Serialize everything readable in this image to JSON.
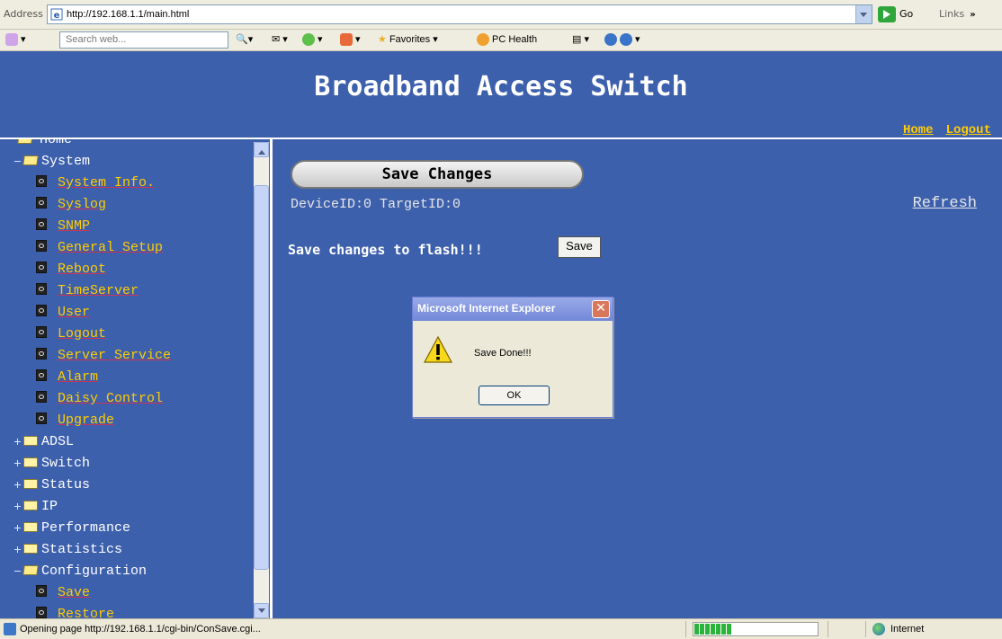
{
  "address_bar": {
    "label": "Address",
    "url": "http://192.168.1.1/main.html",
    "go_label": "Go",
    "links_label": "Links"
  },
  "toolbar": {
    "search_placeholder": "Search web...",
    "favorites_label": "Favorites",
    "pc_health_label": "PC Health"
  },
  "header": {
    "title": "Broadband Access Switch",
    "home_link": "Home",
    "logout_link": "Logout"
  },
  "sidebar": {
    "root_label": "Home",
    "items": [
      {
        "label": "System",
        "type": "folder",
        "expanded": true,
        "indent": 1
      },
      {
        "label": "System Info.",
        "type": "page",
        "indent": 2
      },
      {
        "label": "Syslog",
        "type": "page",
        "indent": 2
      },
      {
        "label": "SNMP",
        "type": "page",
        "indent": 2
      },
      {
        "label": "General Setup",
        "type": "page",
        "indent": 2
      },
      {
        "label": "Reboot",
        "type": "page",
        "indent": 2
      },
      {
        "label": "TimeServer",
        "type": "page",
        "indent": 2
      },
      {
        "label": "User",
        "type": "page",
        "indent": 2
      },
      {
        "label": "Logout",
        "type": "page",
        "indent": 2
      },
      {
        "label": "Server Service",
        "type": "page",
        "indent": 2
      },
      {
        "label": "Alarm",
        "type": "page",
        "indent": 2
      },
      {
        "label": "Daisy Control",
        "type": "page",
        "indent": 2
      },
      {
        "label": "Upgrade",
        "type": "page",
        "indent": 2
      },
      {
        "label": "ADSL",
        "type": "folder",
        "expanded": false,
        "indent": 1
      },
      {
        "label": "Switch",
        "type": "folder",
        "expanded": false,
        "indent": 1
      },
      {
        "label": "Status",
        "type": "folder",
        "expanded": false,
        "indent": 1
      },
      {
        "label": "IP",
        "type": "folder",
        "expanded": false,
        "indent": 1
      },
      {
        "label": "Performance",
        "type": "folder",
        "expanded": false,
        "indent": 1
      },
      {
        "label": "Statistics",
        "type": "folder",
        "expanded": false,
        "indent": 1
      },
      {
        "label": "Configuration",
        "type": "folder",
        "expanded": true,
        "indent": 1
      },
      {
        "label": "Save",
        "type": "page",
        "indent": 2
      },
      {
        "label": "Restore",
        "type": "page",
        "indent": 2
      }
    ]
  },
  "main": {
    "save_changes_title": "Save Changes",
    "device_info": "DeviceID:0 TargetID:0",
    "refresh_link": "Refresh",
    "flash_label": "Save changes to flash!!!",
    "save_button": "Save"
  },
  "dialog": {
    "title": "Microsoft Internet Explorer",
    "message": "Save Done!!!",
    "ok_button": "OK"
  },
  "statusbar": {
    "text": "Opening page http://192.168.1.1/cgi-bin/ConSave.cgi...",
    "zone": "Internet",
    "progress_fraction": 0.3
  },
  "colors": {
    "panel_bg": "#3d60ad",
    "link_yellow": "#ffcc00"
  }
}
